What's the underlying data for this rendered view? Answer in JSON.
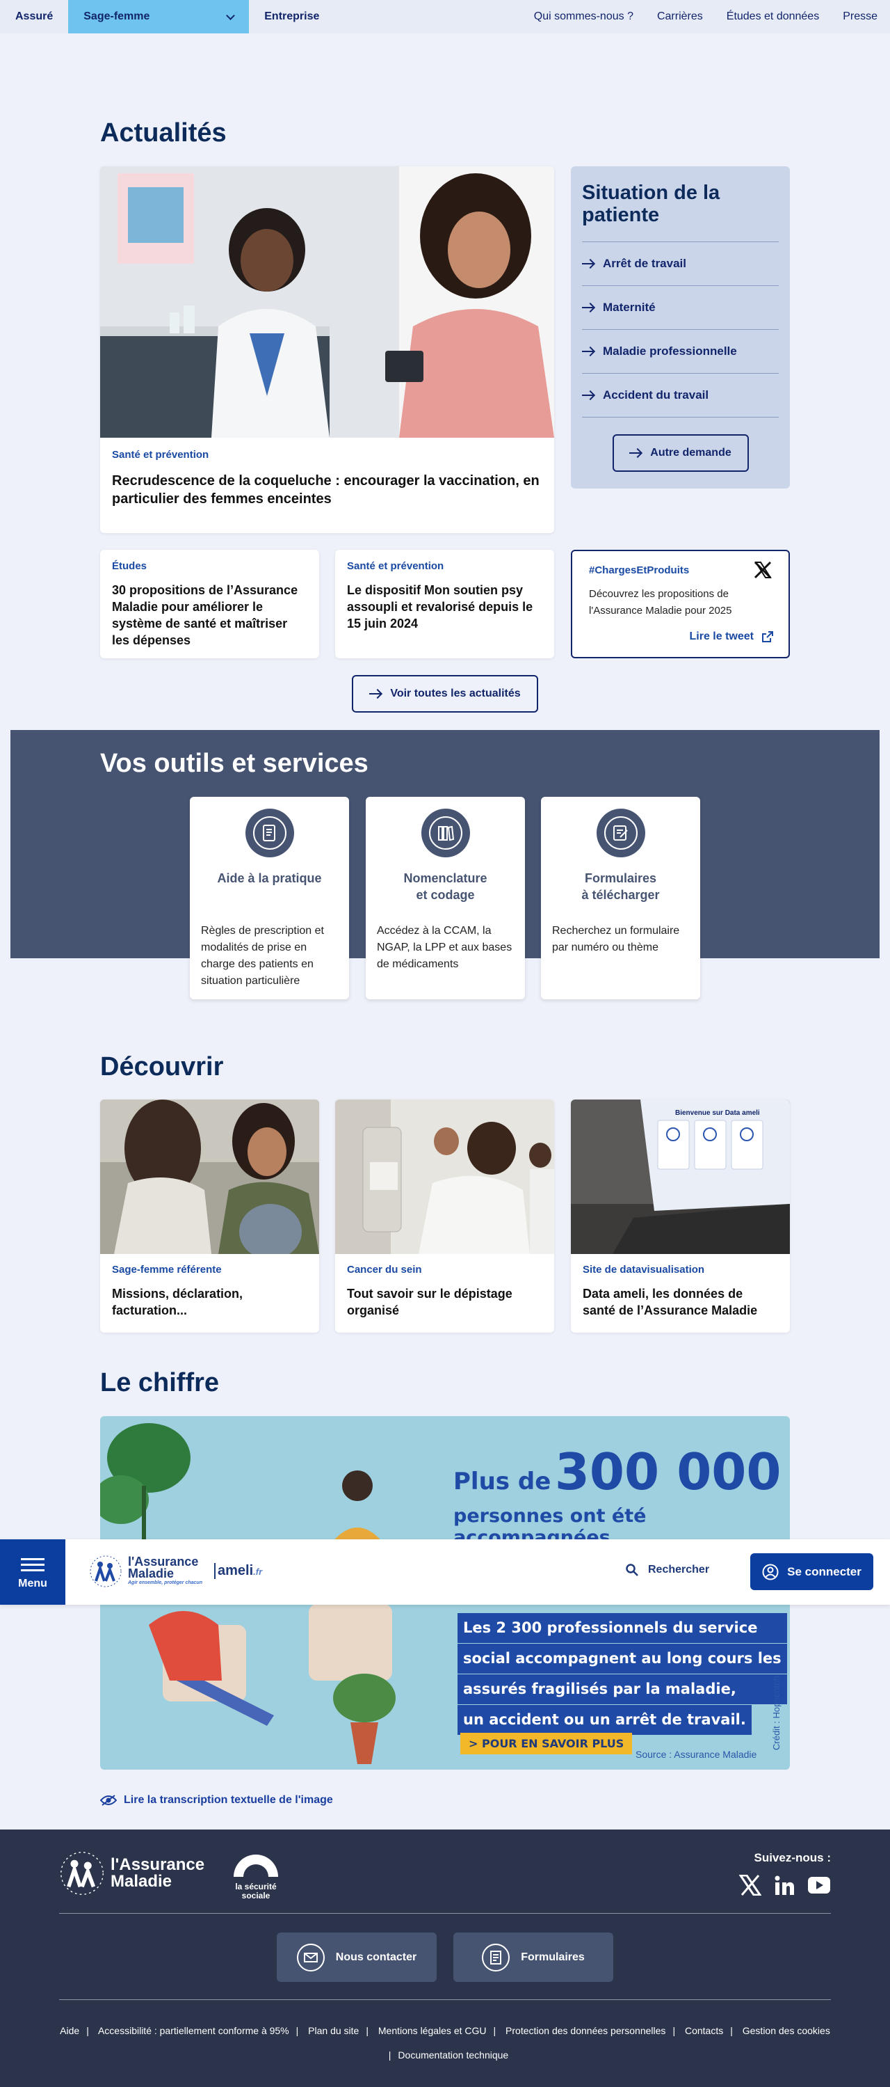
{
  "topnav": {
    "tabs": [
      "Assuré",
      "Sage-femme",
      "Entreprise"
    ],
    "links": [
      "Qui sommes-nous ?",
      "Carrières",
      "Études et données",
      "Presse"
    ]
  },
  "actualites": {
    "title": "Actualités",
    "main": {
      "category": "Santé et prévention",
      "title": "Recrudescence de la coqueluche : encourager la vaccination, en particulier des femmes enceintes"
    },
    "situation": {
      "title": "Situation de la patiente",
      "items": [
        "Arrêt de travail",
        "Maternité",
        "Maladie professionnelle",
        "Accident du travail"
      ],
      "button": "Autre demande"
    },
    "cards": [
      {
        "category": "Études",
        "title": "30 propositions de l’Assurance Maladie pour améliorer le système de santé et maîtriser les dépenses"
      },
      {
        "category": "Santé et prévention",
        "title": "Le dispositif Mon soutien psy assoupli et revalorisé depuis le 15 juin 2024"
      }
    ],
    "tweet": {
      "hashtag": "#ChargesEtProduits",
      "text": "Découvrez les propositions de l'Assurance Maladie pour 2025",
      "link": "Lire le tweet"
    },
    "all_button": "Voir toutes les actualités"
  },
  "outils": {
    "title": "Vos outils et services",
    "tools": [
      {
        "title": "Aide à la pratique",
        "text": "Règles de prescription et modalités de prise en charge des patients en situation particulière"
      },
      {
        "title_l1": "Nomenclature",
        "title_l2": "et codage",
        "text": "Accédez à la CCAM, la NGAP, la LPP et aux bases de médicaments"
      },
      {
        "title_l1": "Formulaires",
        "title_l2": "à télécharger",
        "text": "Recherchez un formulaire par numéro ou thème"
      }
    ]
  },
  "decouvrir": {
    "title": "Découvrir",
    "cards": [
      {
        "category": "Sage-femme référente",
        "title": "Missions, déclaration, facturation..."
      },
      {
        "category": "Cancer du sein",
        "title": "Tout savoir sur le dépistage organisé"
      },
      {
        "category": "Site de datavisualisation",
        "title": "Data ameli, les données de santé de l’Assurance Maladie"
      }
    ],
    "screen_text": "Bienvenue sur Data ameli"
  },
  "chiffre": {
    "title": "Le chiffre",
    "plus_de": "Plus de",
    "number": "300 000",
    "line1": "personnes ont été accompagnées",
    "box_lines": [
      "Les 2 300 professionnels du service",
      "social accompagnent au long cours les",
      "assurés fragilisés par la maladie,",
      "un accident ou un arrêt de travail."
    ],
    "cta": "POUR EN SAVOIR PLUS",
    "source": "Source : Assurance Maladie",
    "credit": "Crédit : Hopscotch",
    "transcription": "Lire la transcription textuelle de l'image"
  },
  "sticky": {
    "menu": "Menu",
    "logo_l1": "l'Assurance",
    "logo_l2": "Maladie",
    "logo_tagline": "Agir ensemble, protéger chacun",
    "ameli": "ameli",
    "ameli_fr": ".fr",
    "search": "Rechercher",
    "connect": "Se connecter"
  },
  "footer": {
    "logo_l1": "l'Assurance",
    "logo_l2": "Maladie",
    "secu_l1": "la sécurité",
    "secu_l2": "sociale",
    "follow": "Suivez-nous :",
    "buttons": [
      "Nous contacter",
      "Formulaires"
    ],
    "links": [
      "Aide",
      "Accessibilité : partiellement conforme à 95%",
      "Plan du site",
      "Mentions légales et CGU",
      "Protection des données personnelles",
      "Contacts",
      "Gestion des cookies"
    ],
    "link_last": "Documentation technique"
  }
}
